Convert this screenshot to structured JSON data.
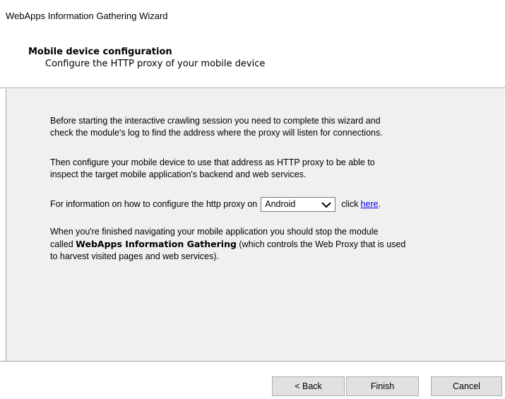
{
  "window": {
    "title": "WebApps Information Gathering Wizard"
  },
  "header": {
    "title": "Mobile device configuration",
    "subtitle": "Configure the HTTP proxy of your mobile device"
  },
  "content": {
    "para1": [
      "Before starting the interactive crawling session you need to complete this wizard and",
      "check the module's log to find the address where the proxy will listen for connections."
    ],
    "para2": [
      "Then configure your mobile device to use that address as HTTP proxy to be able to",
      "inspect the target mobile application's backend and web services."
    ],
    "para3": {
      "prefix": "For information on how to configure the http proxy on",
      "select_value": "Android",
      "click_text": "click",
      "link_text": "here",
      "suffix": "."
    },
    "para4": {
      "line1": "When you're finished navigating your mobile application you should stop the module",
      "line2_prefix": "called ",
      "line2_bold": "WebApps Information Gathering",
      "line2_suffix": " (which controls the Web Proxy that is used",
      "line3": "to harvest visited pages and web services)."
    }
  },
  "footer": {
    "back_label": "< Back",
    "finish_label": "Finish",
    "cancel_label": "Cancel"
  },
  "icons": {
    "dropdown": "chevron-down-icon"
  }
}
